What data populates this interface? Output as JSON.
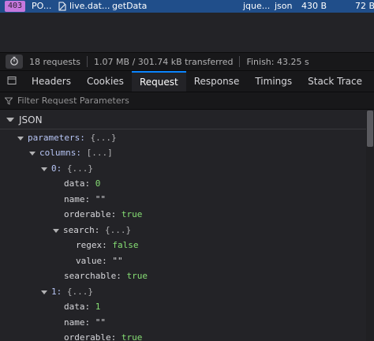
{
  "request_row": {
    "status": "403",
    "method": "PO...",
    "file": "live.dat...",
    "cause": "getData",
    "initiator": "jque...",
    "type": "json",
    "transferred": "430 B",
    "size": "72 B"
  },
  "summary": {
    "requests": "18 requests",
    "transferred": "1.07 MB / 301.74 kB transferred",
    "finish": "Finish: 43.25 s"
  },
  "tabs": [
    {
      "label": "Headers"
    },
    {
      "label": "Cookies"
    },
    {
      "label": "Request"
    },
    {
      "label": "Response"
    },
    {
      "label": "Timings"
    },
    {
      "label": "Stack Trace"
    }
  ],
  "active_tab": "Request",
  "filter": {
    "placeholder": "Filter Request Parameters"
  },
  "section_title": "JSON",
  "tree": {
    "parameters_key": "parameters:",
    "parameters_summary": "{...}",
    "columns_key": "columns:",
    "columns_summary": "[...]",
    "col0_key": "0:",
    "col0_summary": "{...}",
    "col0_data_key": "data:",
    "col0_data_val": "0",
    "col0_name_key": "name:",
    "col0_name_val": "\"\"",
    "col0_orderable_key": "orderable:",
    "col0_orderable_val": "true",
    "col0_search_key": "search:",
    "col0_search_summary": "{...}",
    "col0_regex_key": "regex:",
    "col0_regex_val": "false",
    "col0_value_key": "value:",
    "col0_value_val": "\"\"",
    "col0_searchable_key": "searchable:",
    "col0_searchable_val": "true",
    "col1_key": "1:",
    "col1_summary": "{...}",
    "col1_data_key": "data:",
    "col1_data_val": "1",
    "col1_name_key": "name:",
    "col1_name_val": "\"\"",
    "col1_orderable_key": "orderable:",
    "col1_orderable_val": "true"
  },
  "colors": {
    "selected_row": "#204e8a",
    "status_badge": "#c678dd",
    "active_tab_accent": "#0a84ff",
    "value_green": "#86de74"
  }
}
